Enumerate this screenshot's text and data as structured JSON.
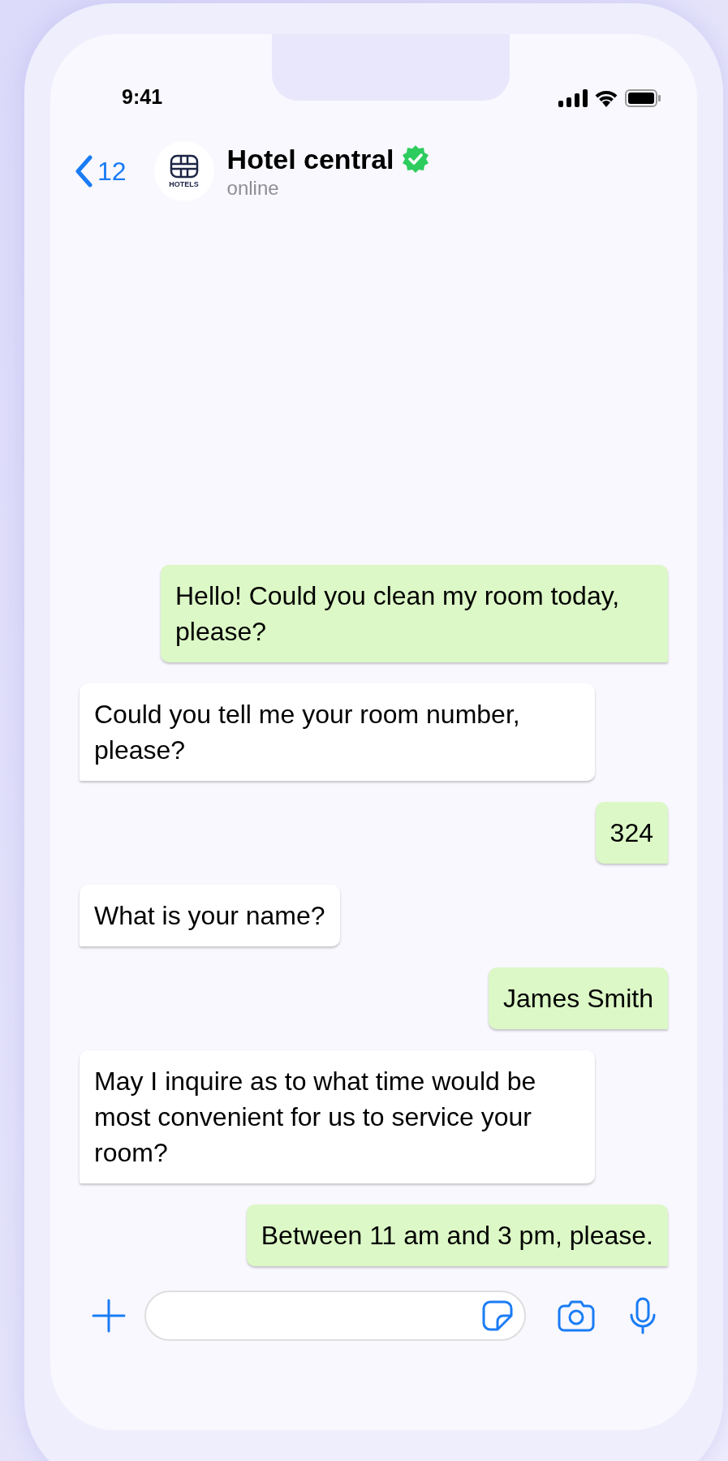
{
  "status_bar": {
    "time": "9:41"
  },
  "header": {
    "back_count": "12",
    "logo_text": "HOTELS",
    "title": "Hotel central",
    "verified": true,
    "subtitle": "online"
  },
  "messages": [
    {
      "kind": "sent",
      "text": "Hello! Could you clean my room today, please?"
    },
    {
      "kind": "received",
      "text": "Could you tell me your room number, please?"
    },
    {
      "kind": "sent",
      "text": "324"
    },
    {
      "kind": "received",
      "text": "What is your name?"
    },
    {
      "kind": "sent",
      "text": "James Smith"
    },
    {
      "kind": "received",
      "text": "May I inquire as to what time would be most convenient for us to service your room?"
    },
    {
      "kind": "sent",
      "text": "Between 11 am and 3 pm, please."
    }
  ]
}
